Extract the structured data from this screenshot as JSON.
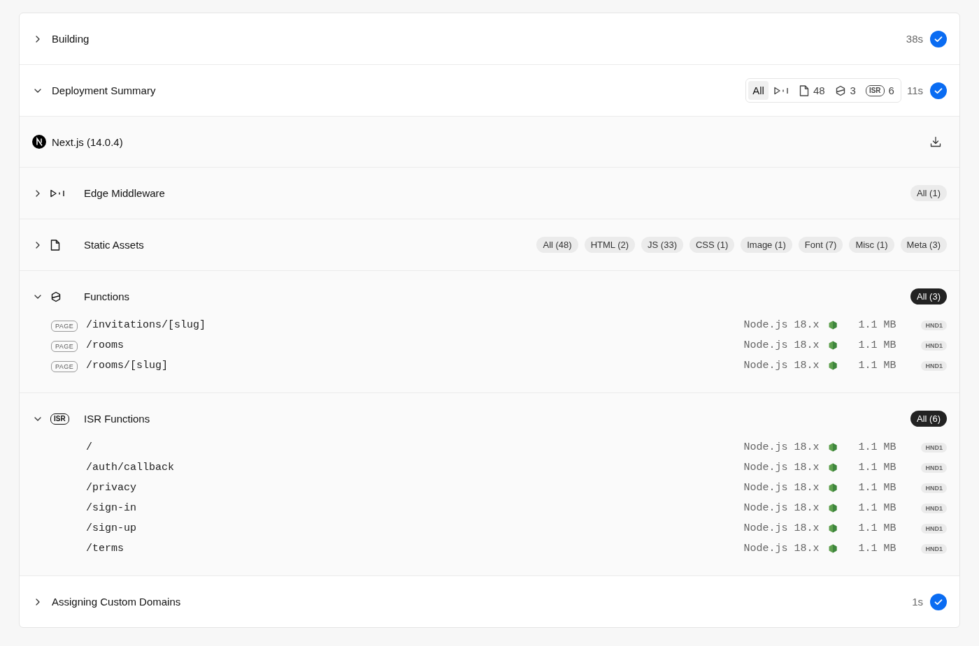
{
  "steps": [
    {
      "kind": "step",
      "title": "Building",
      "expanded": false,
      "duration": "38s",
      "done": true
    },
    {
      "kind": "summary",
      "title": "Deployment Summary",
      "expanded": true,
      "duration": "11s",
      "done": true,
      "filters": [
        {
          "kind": "all",
          "label": "All",
          "selected": true
        },
        {
          "kind": "edge",
          "selected": false
        },
        {
          "kind": "static",
          "label": "48",
          "selected": false
        },
        {
          "kind": "functions",
          "label": "3",
          "selected": false
        },
        {
          "kind": "isr",
          "badge": "ISR",
          "label": "6",
          "selected": false
        }
      ],
      "framework": "Next.js (14.0.4)",
      "sections": [
        {
          "kind": "edge",
          "title": "Edge Middleware",
          "expanded": false,
          "chips": [
            {
              "label": "All (1)",
              "selected": false
            }
          ]
        },
        {
          "kind": "static",
          "title": "Static Assets",
          "expanded": false,
          "chips": [
            {
              "label": "All (48)",
              "selected": false
            },
            {
              "label": "HTML (2)",
              "selected": false
            },
            {
              "label": "JS (33)",
              "selected": false
            },
            {
              "label": "CSS (1)",
              "selected": false
            },
            {
              "label": "Image (1)",
              "selected": false
            },
            {
              "label": "Font (7)",
              "selected": false
            },
            {
              "label": "Misc (1)",
              "selected": false
            },
            {
              "label": "Meta (3)",
              "selected": false
            }
          ]
        },
        {
          "kind": "functions",
          "title": "Functions",
          "expanded": true,
          "chips": [
            {
              "label": "All (3)",
              "selected": true
            }
          ],
          "rows": [
            {
              "badge": "PAGE",
              "path": "/invitations/[slug]",
              "runtime": "Node.js 18.x",
              "size": "1.1 MB",
              "region": "HND1"
            },
            {
              "badge": "PAGE",
              "path": "/rooms",
              "runtime": "Node.js 18.x",
              "size": "1.1 MB",
              "region": "HND1"
            },
            {
              "badge": "PAGE",
              "path": "/rooms/[slug]",
              "runtime": "Node.js 18.x",
              "size": "1.1 MB",
              "region": "HND1"
            }
          ]
        },
        {
          "kind": "isr",
          "badge": "ISR",
          "title": "ISR Functions",
          "expanded": true,
          "chips": [
            {
              "label": "All (6)",
              "selected": true
            }
          ],
          "rows": [
            {
              "path": "/",
              "runtime": "Node.js 18.x",
              "size": "1.1 MB",
              "region": "HND1"
            },
            {
              "path": "/auth/callback",
              "runtime": "Node.js 18.x",
              "size": "1.1 MB",
              "region": "HND1"
            },
            {
              "path": "/privacy",
              "runtime": "Node.js 18.x",
              "size": "1.1 MB",
              "region": "HND1"
            },
            {
              "path": "/sign-in",
              "runtime": "Node.js 18.x",
              "size": "1.1 MB",
              "region": "HND1"
            },
            {
              "path": "/sign-up",
              "runtime": "Node.js 18.x",
              "size": "1.1 MB",
              "region": "HND1"
            },
            {
              "path": "/terms",
              "runtime": "Node.js 18.x",
              "size": "1.1 MB",
              "region": "HND1"
            }
          ]
        }
      ]
    },
    {
      "kind": "step",
      "title": "Assigning Custom Domains",
      "expanded": false,
      "duration": "1s",
      "done": true
    }
  ]
}
